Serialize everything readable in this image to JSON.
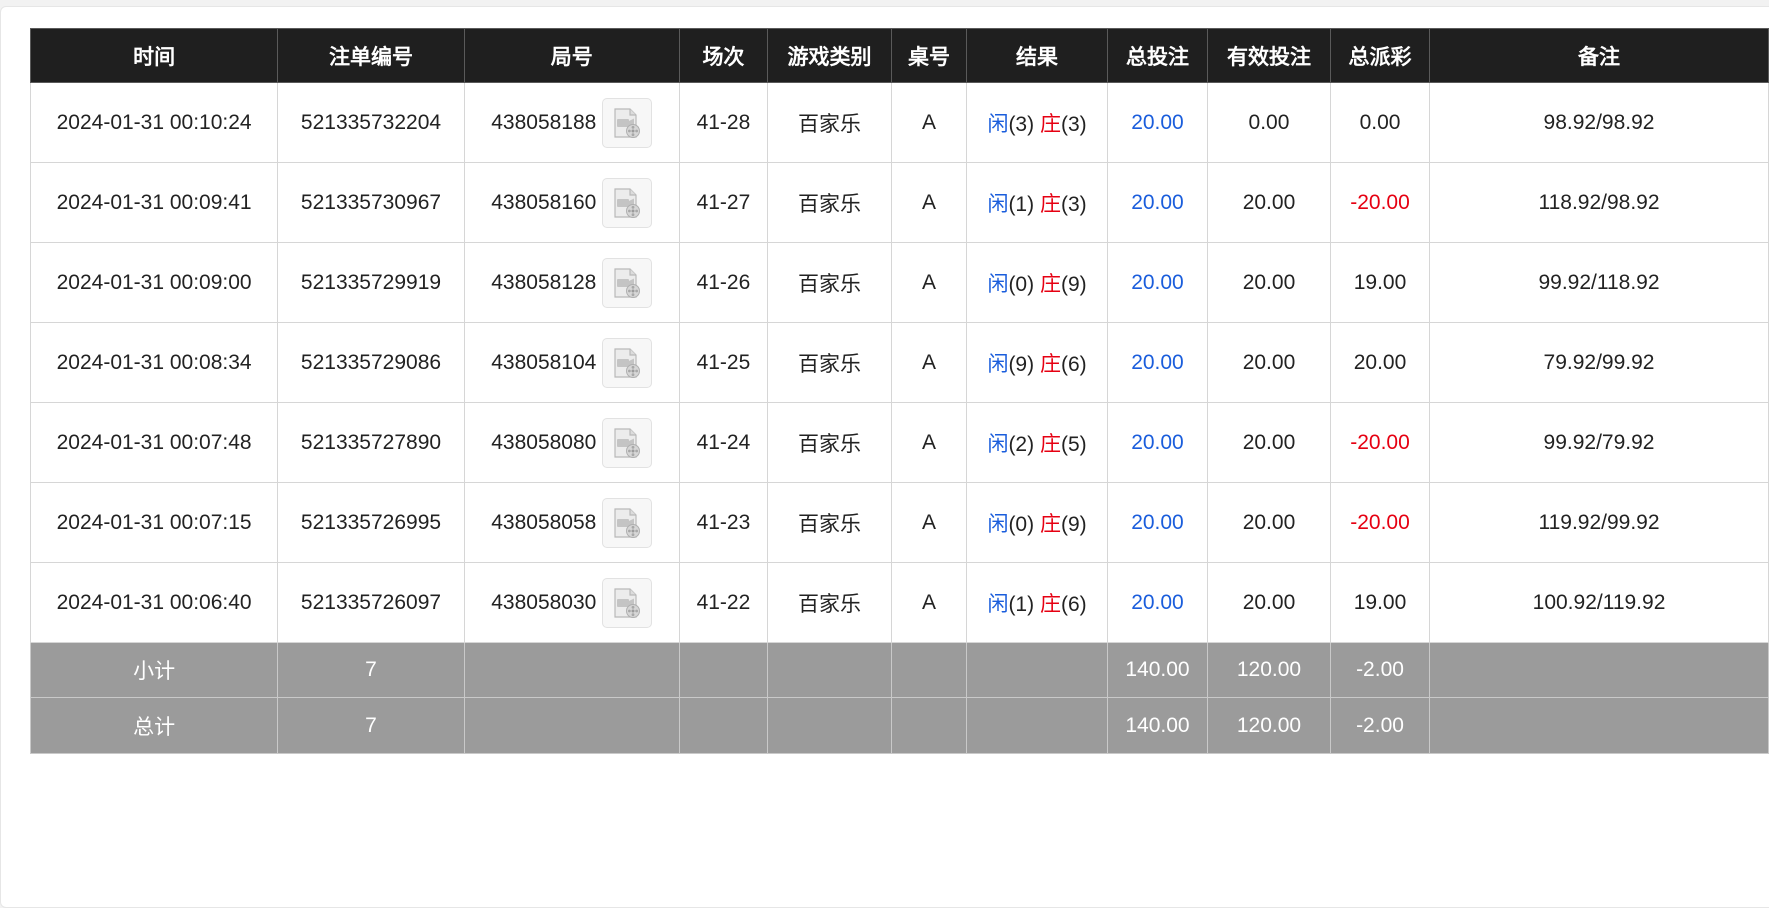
{
  "colors": {
    "header_bg": "#1f1f1f",
    "footer_bg": "#9b9b9b",
    "player_blue": "#1a5ddc",
    "banker_red": "#e60012",
    "accent": "#3d7de6"
  },
  "columns": [
    "时间",
    "注单编号",
    "局号",
    "场次",
    "游戏类别",
    "桌号",
    "结果",
    "总投注",
    "有效投注",
    "总派彩",
    "备注"
  ],
  "rows": [
    {
      "time": "2024-01-31 00:10:24",
      "order_no": "521335732204",
      "round_no": "438058188",
      "session": "41-28",
      "game": "百家乐",
      "table": "A",
      "player_label": "闲",
      "player_score": "(3)",
      "banker_label": "庄",
      "banker_score": "(3)",
      "total_bet": "20.00",
      "valid_bet": "0.00",
      "payout": "0.00",
      "payout_negative": false,
      "remark": "98.92/98.92"
    },
    {
      "time": "2024-01-31 00:09:41",
      "order_no": "521335730967",
      "round_no": "438058160",
      "session": "41-27",
      "game": "百家乐",
      "table": "A",
      "player_label": "闲",
      "player_score": "(1)",
      "banker_label": "庄",
      "banker_score": "(3)",
      "total_bet": "20.00",
      "valid_bet": "20.00",
      "payout": "-20.00",
      "payout_negative": true,
      "remark": "118.92/98.92"
    },
    {
      "time": "2024-01-31 00:09:00",
      "order_no": "521335729919",
      "round_no": "438058128",
      "session": "41-26",
      "game": "百家乐",
      "table": "A",
      "player_label": "闲",
      "player_score": "(0)",
      "banker_label": "庄",
      "banker_score": "(9)",
      "total_bet": "20.00",
      "valid_bet": "20.00",
      "payout": "19.00",
      "payout_negative": false,
      "remark": "99.92/118.92"
    },
    {
      "time": "2024-01-31 00:08:34",
      "order_no": "521335729086",
      "round_no": "438058104",
      "session": "41-25",
      "game": "百家乐",
      "table": "A",
      "player_label": "闲",
      "player_score": "(9)",
      "banker_label": "庄",
      "banker_score": "(6)",
      "total_bet": "20.00",
      "valid_bet": "20.00",
      "payout": "20.00",
      "payout_negative": false,
      "remark": "79.92/99.92"
    },
    {
      "time": "2024-01-31 00:07:48",
      "order_no": "521335727890",
      "round_no": "438058080",
      "session": "41-24",
      "game": "百家乐",
      "table": "A",
      "player_label": "闲",
      "player_score": "(2)",
      "banker_label": "庄",
      "banker_score": "(5)",
      "total_bet": "20.00",
      "valid_bet": "20.00",
      "payout": "-20.00",
      "payout_negative": true,
      "remark": "99.92/79.92"
    },
    {
      "time": "2024-01-31 00:07:15",
      "order_no": "521335726995",
      "round_no": "438058058",
      "session": "41-23",
      "game": "百家乐",
      "table": "A",
      "player_label": "闲",
      "player_score": "(0)",
      "banker_label": "庄",
      "banker_score": "(9)",
      "total_bet": "20.00",
      "valid_bet": "20.00",
      "payout": "-20.00",
      "payout_negative": true,
      "remark": "119.92/99.92"
    },
    {
      "time": "2024-01-31 00:06:40",
      "order_no": "521335726097",
      "round_no": "438058030",
      "session": "41-22",
      "game": "百家乐",
      "table": "A",
      "player_label": "闲",
      "player_score": "(1)",
      "banker_label": "庄",
      "banker_score": "(6)",
      "total_bet": "20.00",
      "valid_bet": "20.00",
      "payout": "19.00",
      "payout_negative": false,
      "remark": "100.92/119.92"
    }
  ],
  "subtotal": {
    "label": "小计",
    "count": "7",
    "total_bet": "140.00",
    "valid_bet": "120.00",
    "payout": "-2.00"
  },
  "total": {
    "label": "总计",
    "count": "7",
    "total_bet": "140.00",
    "valid_bet": "120.00",
    "payout": "-2.00"
  },
  "icons": {
    "replay": "video-replay-icon"
  }
}
